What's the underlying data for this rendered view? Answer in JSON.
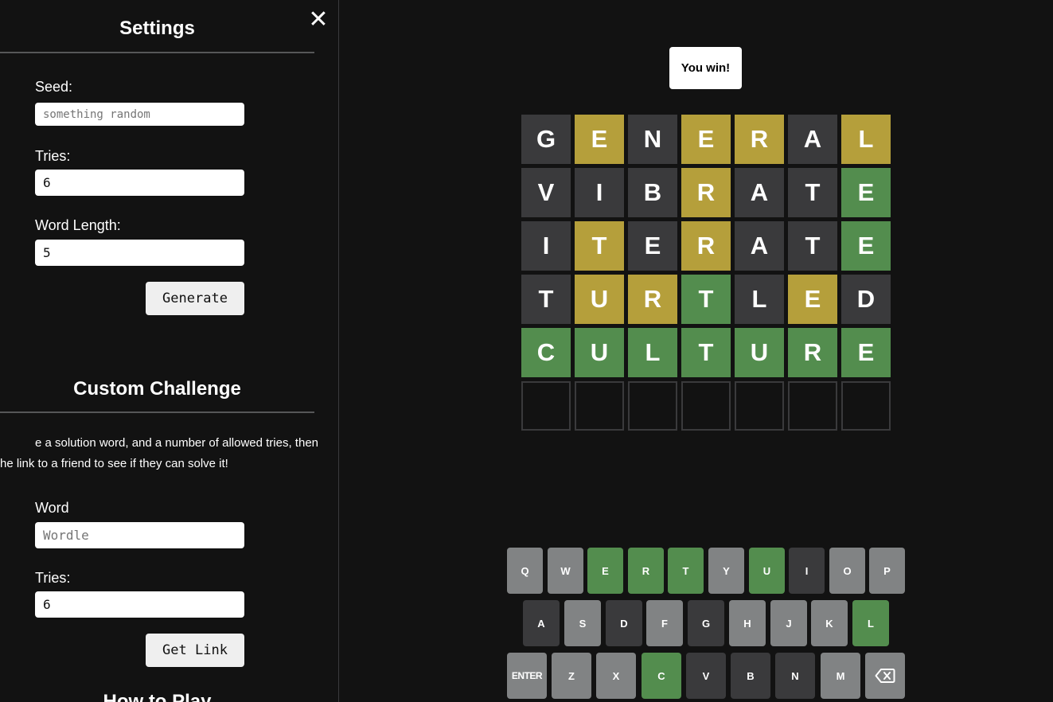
{
  "settings": {
    "title": "Settings",
    "close_label": "✕",
    "seed_label": "Seed:",
    "seed_placeholder": "something random",
    "tries_label": "Tries:",
    "tries_value": "6",
    "word_length_label": "Word Length:",
    "word_length_value": "5",
    "generate_label": "Generate"
  },
  "challenge": {
    "title": "Custom Challenge",
    "description_line1": "e a solution word, and a number of allowed tries, then",
    "description_line2": "he link to a friend to see if they can solve it!",
    "word_label": "Word",
    "word_placeholder": "Wordle",
    "tries_label": "Tries:",
    "tries_value": "6",
    "get_link_label": "Get Link"
  },
  "how_to_play_title": "How to Play",
  "toast": "You win!",
  "board": [
    [
      [
        "G",
        "absent"
      ],
      [
        "E",
        "present"
      ],
      [
        "N",
        "absent"
      ],
      [
        "E",
        "present"
      ],
      [
        "R",
        "present"
      ],
      [
        "A",
        "absent"
      ],
      [
        "L",
        "present"
      ]
    ],
    [
      [
        "V",
        "absent"
      ],
      [
        "I",
        "absent"
      ],
      [
        "B",
        "absent"
      ],
      [
        "R",
        "present"
      ],
      [
        "A",
        "absent"
      ],
      [
        "T",
        "absent"
      ],
      [
        "E",
        "correct"
      ]
    ],
    [
      [
        "I",
        "absent"
      ],
      [
        "T",
        "present"
      ],
      [
        "E",
        "absent"
      ],
      [
        "R",
        "present"
      ],
      [
        "A",
        "absent"
      ],
      [
        "T",
        "absent"
      ],
      [
        "E",
        "correct"
      ]
    ],
    [
      [
        "T",
        "absent"
      ],
      [
        "U",
        "present"
      ],
      [
        "R",
        "present"
      ],
      [
        "T",
        "correct"
      ],
      [
        "L",
        "absent"
      ],
      [
        "E",
        "present"
      ],
      [
        "D",
        "absent"
      ]
    ],
    [
      [
        "C",
        "correct"
      ],
      [
        "U",
        "correct"
      ],
      [
        "L",
        "correct"
      ],
      [
        "T",
        "correct"
      ],
      [
        "U",
        "correct"
      ],
      [
        "R",
        "correct"
      ],
      [
        "E",
        "correct"
      ]
    ],
    [
      [
        "",
        "empty"
      ],
      [
        "",
        "empty"
      ],
      [
        "",
        "empty"
      ],
      [
        "",
        "empty"
      ],
      [
        "",
        "empty"
      ],
      [
        "",
        "empty"
      ],
      [
        "",
        "empty"
      ]
    ]
  ],
  "keyboard": [
    [
      [
        "Q",
        "unused"
      ],
      [
        "W",
        "unused"
      ],
      [
        "E",
        "correct"
      ],
      [
        "R",
        "correct"
      ],
      [
        "T",
        "correct"
      ],
      [
        "Y",
        "unused"
      ],
      [
        "U",
        "correct"
      ],
      [
        "I",
        "absent"
      ],
      [
        "O",
        "unused"
      ],
      [
        "P",
        "unused"
      ]
    ],
    [
      [
        "A",
        "absent"
      ],
      [
        "S",
        "unused"
      ],
      [
        "D",
        "absent"
      ],
      [
        "F",
        "unused"
      ],
      [
        "G",
        "absent"
      ],
      [
        "H",
        "unused"
      ],
      [
        "J",
        "unused"
      ],
      [
        "K",
        "unused"
      ],
      [
        "L",
        "correct"
      ]
    ],
    [
      [
        "ENTER",
        "unused"
      ],
      [
        "Z",
        "unused"
      ],
      [
        "X",
        "unused"
      ],
      [
        "C",
        "correct"
      ],
      [
        "V",
        "absent"
      ],
      [
        "B",
        "absent"
      ],
      [
        "N",
        "absent"
      ],
      [
        "M",
        "unused"
      ],
      [
        "backspace-icon",
        "unused"
      ]
    ]
  ],
  "colors": {
    "background": "#121212",
    "absent": "#3a3a3c",
    "present": "#b59f3b",
    "correct": "#538d4e",
    "unused_key": "#818384"
  }
}
